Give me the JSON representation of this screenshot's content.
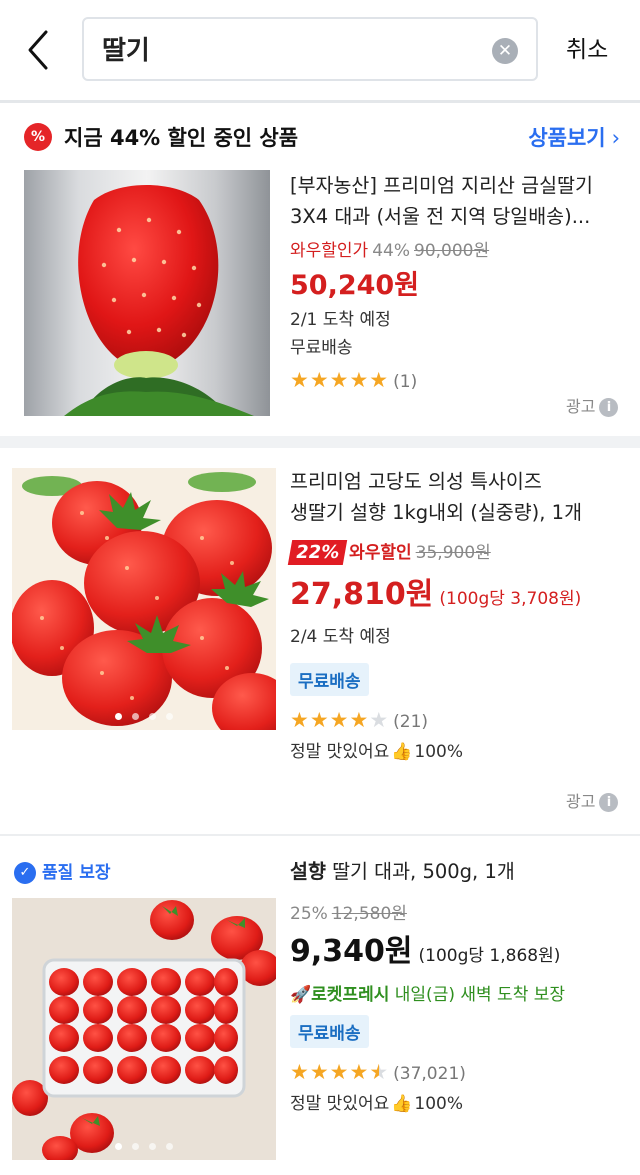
{
  "header": {
    "search_value": "딸기",
    "cancel_label": "취소"
  },
  "promo": {
    "badge": "%",
    "title": "지금 44% 할인 중인 상품",
    "link_label": "상품보기",
    "product": {
      "title_line1": "[부자농산] 프리미엄 지리산 금실딸기",
      "title_line2": "3X4 대과 (서울 전 지역 당일배송)...",
      "wow_label": "와우할인가",
      "discount_pct": "44%",
      "original_price": "90,000원",
      "price": "50,240원",
      "arrival": "2/1 도착 예정",
      "shipping": "무료배송",
      "rating": 5,
      "review_count": "(1)",
      "ad_label": "광고"
    }
  },
  "product2": {
    "title_line1": "프리미엄 고당도 의성 특사이즈",
    "title_line2": "생딸기 설향 1kg내외 (실중량), 1개",
    "discount_badge": "22%",
    "wow_label": "와우할인",
    "original_price": "35,900원",
    "price": "27,810원",
    "unit_price": "(100g당 3,708원)",
    "arrival": "2/4 도착 예정",
    "shipping": "무료배송",
    "rating": 4,
    "review_count": "(21)",
    "feedback": "정말 맛있어요",
    "feedback_pct": "100%",
    "ad_label": "광고"
  },
  "product3": {
    "quality_label": "품질 보장",
    "title_bold": "설향",
    "title_rest": " 딸기 대과, 500g, 1개",
    "discount_pct": "25%",
    "original_price": "12,580원",
    "price": "9,340원",
    "unit_price": "(100g당 1,868원)",
    "rocket_label": "로켓프레시",
    "delivery_text": "내일(금) 새벽 도착 보장",
    "shipping": "무료배송",
    "rating": 4.5,
    "review_count": "(37,021)",
    "feedback": "정말 맛있어요",
    "feedback_pct": "100%"
  },
  "colors": {
    "accent_blue": "#2a6ef0",
    "sale_red": "#d41f1f",
    "rocket_green": "#2f8f1f",
    "star_yellow": "#f5a623"
  }
}
